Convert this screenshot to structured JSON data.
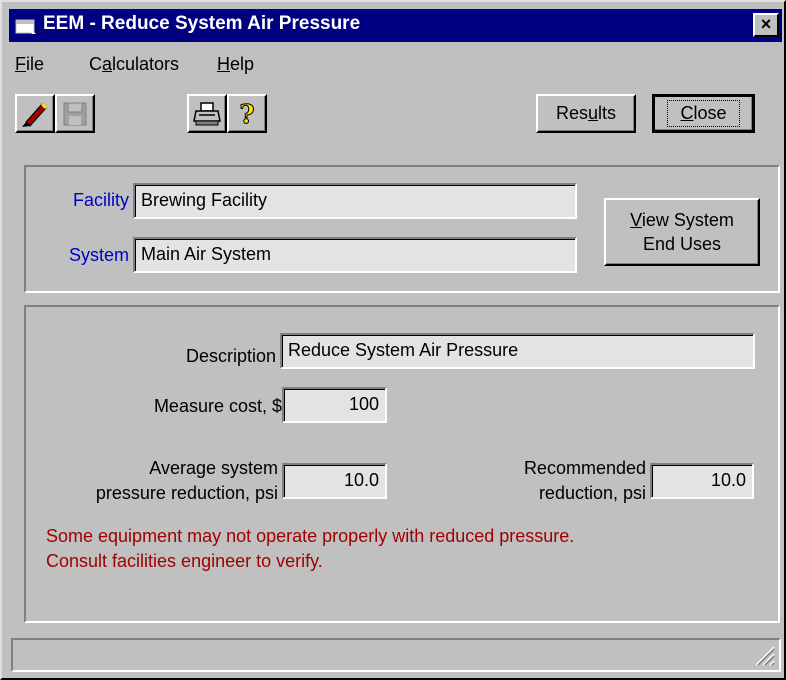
{
  "window": {
    "title": "EEM - Reduce System Air Pressure",
    "close_glyph": "×"
  },
  "menu": [
    {
      "pre": "",
      "ul": "F",
      "post": "ile"
    },
    {
      "pre": "C",
      "ul": "a",
      "post": "lculators"
    },
    {
      "pre": "",
      "ul": "H",
      "post": "elp"
    }
  ],
  "toolbar": {
    "results_pre": "Res",
    "results_ul": "u",
    "results_post": "lts",
    "close_pre": "",
    "close_ul": "C",
    "close_post": "lose"
  },
  "header": {
    "facility_label": "Facility",
    "facility_value": "Brewing Facility",
    "system_label": "System",
    "system_value": "Main Air System",
    "view_button_ul": "V",
    "view_button_line1_rest": "iew System",
    "view_button_line2": "End Uses"
  },
  "form": {
    "description_label": "Description",
    "description_value": "Reduce System Air Pressure",
    "cost_label": "Measure cost, $",
    "cost_value": "100",
    "avg_label_line1": "Average system",
    "avg_label_line2": "pressure reduction, psi",
    "avg_value": "10.0",
    "rec_label_line1": "Recommended",
    "rec_label_line2": "reduction, psi",
    "rec_value": "10.0",
    "warning_line1": "Some equipment may not operate properly with reduced pressure.",
    "warning_line2": "Consult facilities engineer to verify."
  },
  "icons": [
    "app-window-icon",
    "pencil-icon",
    "save-disk-icon",
    "printer-icon",
    "help-question-icon",
    "resize-grip-icon"
  ],
  "colors": {
    "title_bar": "#000080",
    "face": "#c0c0c0",
    "label_blue": "#0000c8",
    "warning_red": "#a00000"
  }
}
